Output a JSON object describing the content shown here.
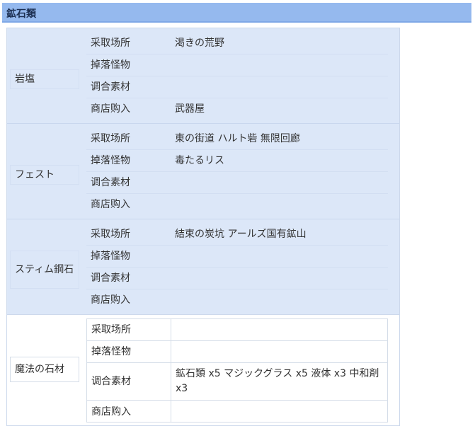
{
  "header": {
    "title": "鉱石類"
  },
  "labels": {
    "source": "采取场所",
    "drop": "掉落怪物",
    "craft": "调合素材",
    "shop": "商店购入"
  },
  "items": [
    {
      "name": "岩塩",
      "source": "渇きの荒野",
      "drop": "",
      "craft": "",
      "shop": "武器屋"
    },
    {
      "name": "フェスト",
      "source": "東の街道 ハルト砦 無限回廊",
      "drop": "毒たるリス",
      "craft": "",
      "shop": ""
    },
    {
      "name": "スティム鋼石",
      "source": "結束の炭坑 アールズ国有鉱山",
      "drop": "",
      "craft": "",
      "shop": ""
    },
    {
      "name": "魔法の石材",
      "source": "",
      "drop": "",
      "craft": "鉱石類 x5 マジックグラス x5 液体 x3 中和剤 x3",
      "shop": ""
    }
  ]
}
